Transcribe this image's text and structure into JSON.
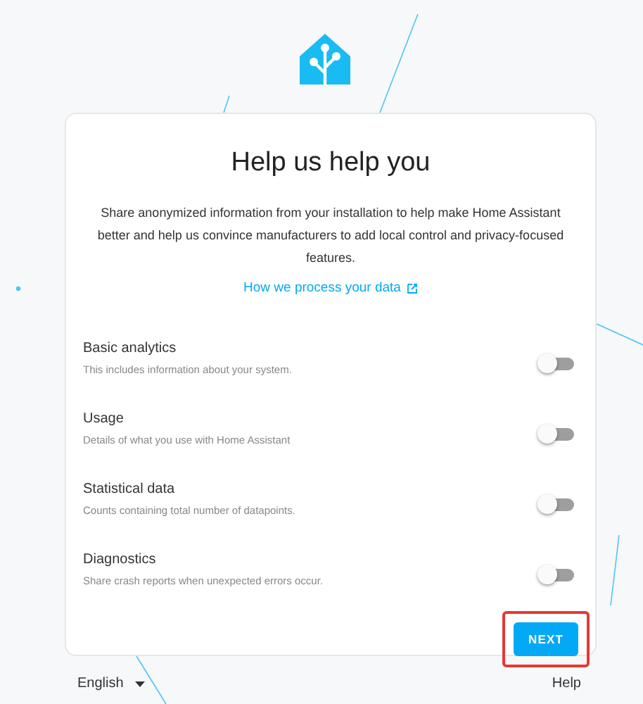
{
  "title": "Help us help you",
  "description": "Share anonymized information from your installation to help make Home Assistant better and help us convince manufacturers to add local control and privacy-focused features.",
  "link": {
    "label": "How we process your data"
  },
  "options": [
    {
      "title": "Basic analytics",
      "subtitle": "This includes information about your system.",
      "on": false
    },
    {
      "title": "Usage",
      "subtitle": "Details of what you use with Home Assistant",
      "on": false
    },
    {
      "title": "Statistical data",
      "subtitle": "Counts containing total number of datapoints.",
      "on": false
    },
    {
      "title": "Diagnostics",
      "subtitle": "Share crash reports when unexpected errors occur.",
      "on": false
    }
  ],
  "next_button": {
    "label": "NEXT",
    "highlighted": true
  },
  "footer": {
    "language": "English",
    "help": "Help"
  }
}
